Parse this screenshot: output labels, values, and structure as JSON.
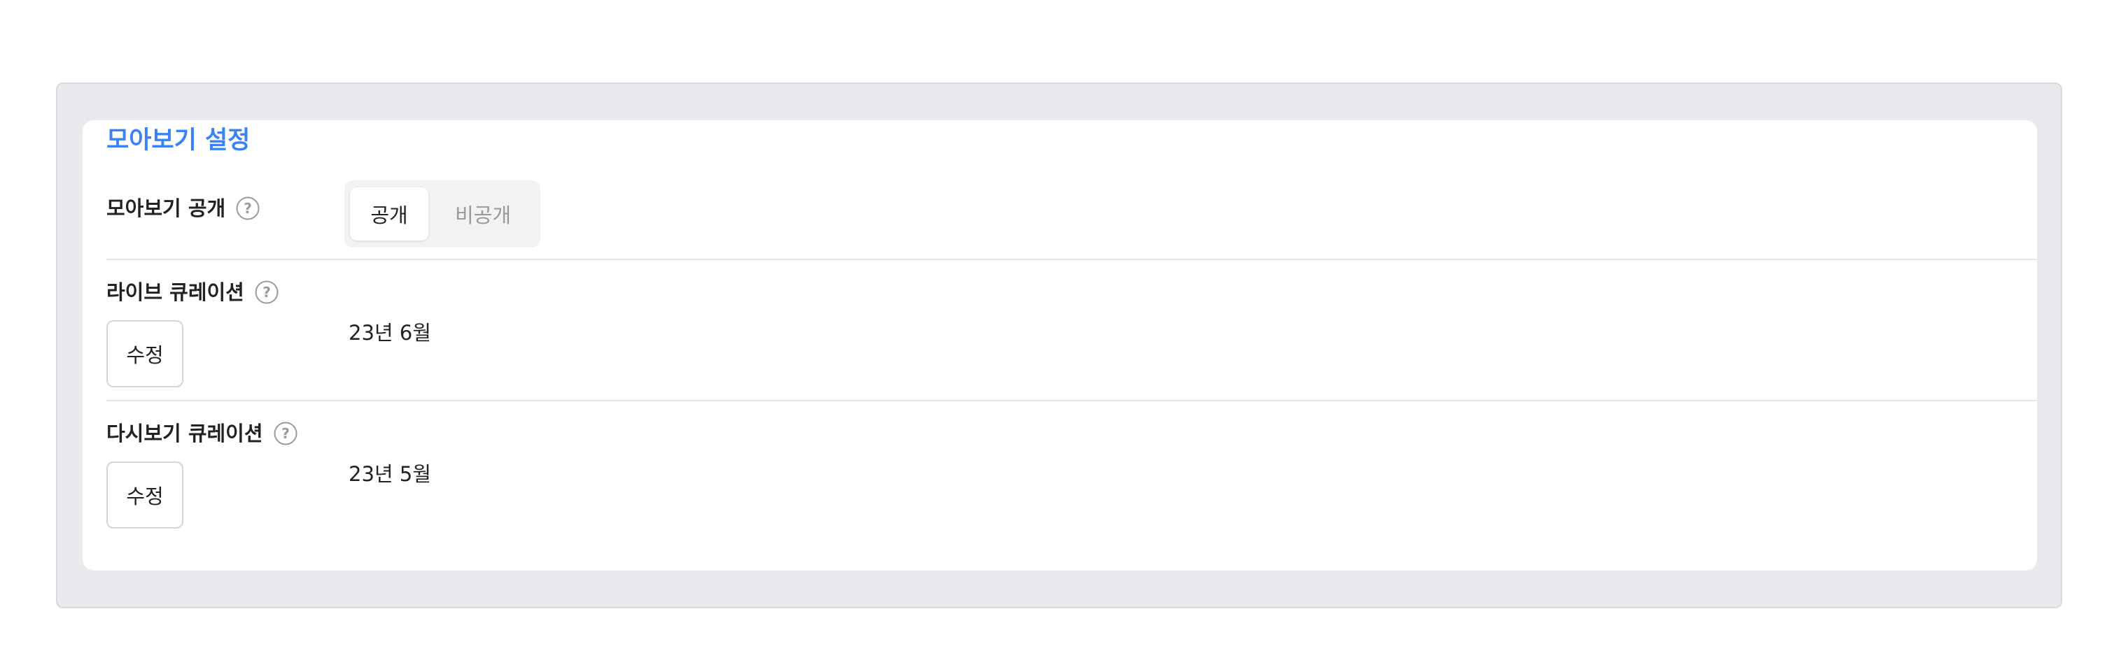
{
  "settings": {
    "title": "모아보기 설정",
    "visibility": {
      "label": "모아보기 공개",
      "options": [
        "공개",
        "비공개"
      ],
      "selected": "공개"
    },
    "live_curation": {
      "label": "라이브 큐레이션",
      "button_label": "수정",
      "value": "23년 6월"
    },
    "replay_curation": {
      "label": "다시보기 큐레이션",
      "button_label": "수정",
      "value": "23년 5월"
    }
  },
  "icons": {
    "help": "question-circle-icon"
  },
  "colors": {
    "accent": "#3b82f6",
    "panel_background": "#e9eaee",
    "toggle_background": "#f1f2f4",
    "muted_text": "#999999"
  }
}
